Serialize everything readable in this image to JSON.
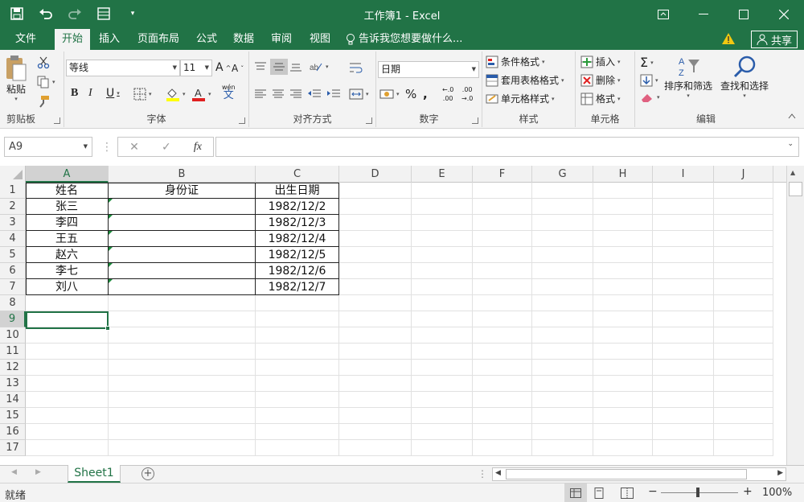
{
  "app": {
    "title": "工作簿1 - Excel",
    "accent": "#217346"
  },
  "tabs": [
    "文件",
    "开始",
    "插入",
    "页面布局",
    "公式",
    "数据",
    "审阅",
    "视图"
  ],
  "active_tab": "开始",
  "tell_me": "告诉我您想要做什么...",
  "share_label": "共享",
  "ribbon": {
    "clipboard": {
      "label": "剪贴板",
      "paste": "粘贴"
    },
    "font": {
      "label": "字体",
      "name": "等线",
      "size": "11",
      "phonetic": "wén",
      "phonetic_char": "文"
    },
    "alignment": {
      "label": "对齐方式"
    },
    "number": {
      "label": "数字",
      "format": "日期"
    },
    "styles": {
      "label": "样式",
      "conditional": "条件格式",
      "table": "套用表格格式",
      "cell": "单元格样式"
    },
    "cells": {
      "label": "单元格",
      "insert": "插入",
      "delete": "删除",
      "format": "格式"
    },
    "editing": {
      "label": "编辑",
      "sort": "排序和筛选",
      "find": "查找和选择"
    }
  },
  "namebox": "A9",
  "columns": [
    "A",
    "B",
    "C",
    "D",
    "E",
    "F",
    "G",
    "H",
    "I",
    "J"
  ],
  "rows": [
    "1",
    "2",
    "3",
    "4",
    "5",
    "6",
    "7",
    "8",
    "9",
    "10",
    "11",
    "12",
    "13",
    "14",
    "15",
    "16",
    "17"
  ],
  "sheet": {
    "headers": [
      "姓名",
      "身份证",
      "出生日期"
    ],
    "data": [
      [
        "张三",
        "",
        "1982/12/2"
      ],
      [
        "李四",
        "",
        "1982/12/3"
      ],
      [
        "王五",
        "",
        "1982/12/4"
      ],
      [
        "赵六",
        "",
        "1982/12/5"
      ],
      [
        "李七",
        "",
        "1982/12/6"
      ],
      [
        "刘八",
        "",
        "1982/12/7"
      ]
    ]
  },
  "sheet_tab": "Sheet1",
  "status": {
    "ready": "就绪",
    "zoom": "100%"
  }
}
